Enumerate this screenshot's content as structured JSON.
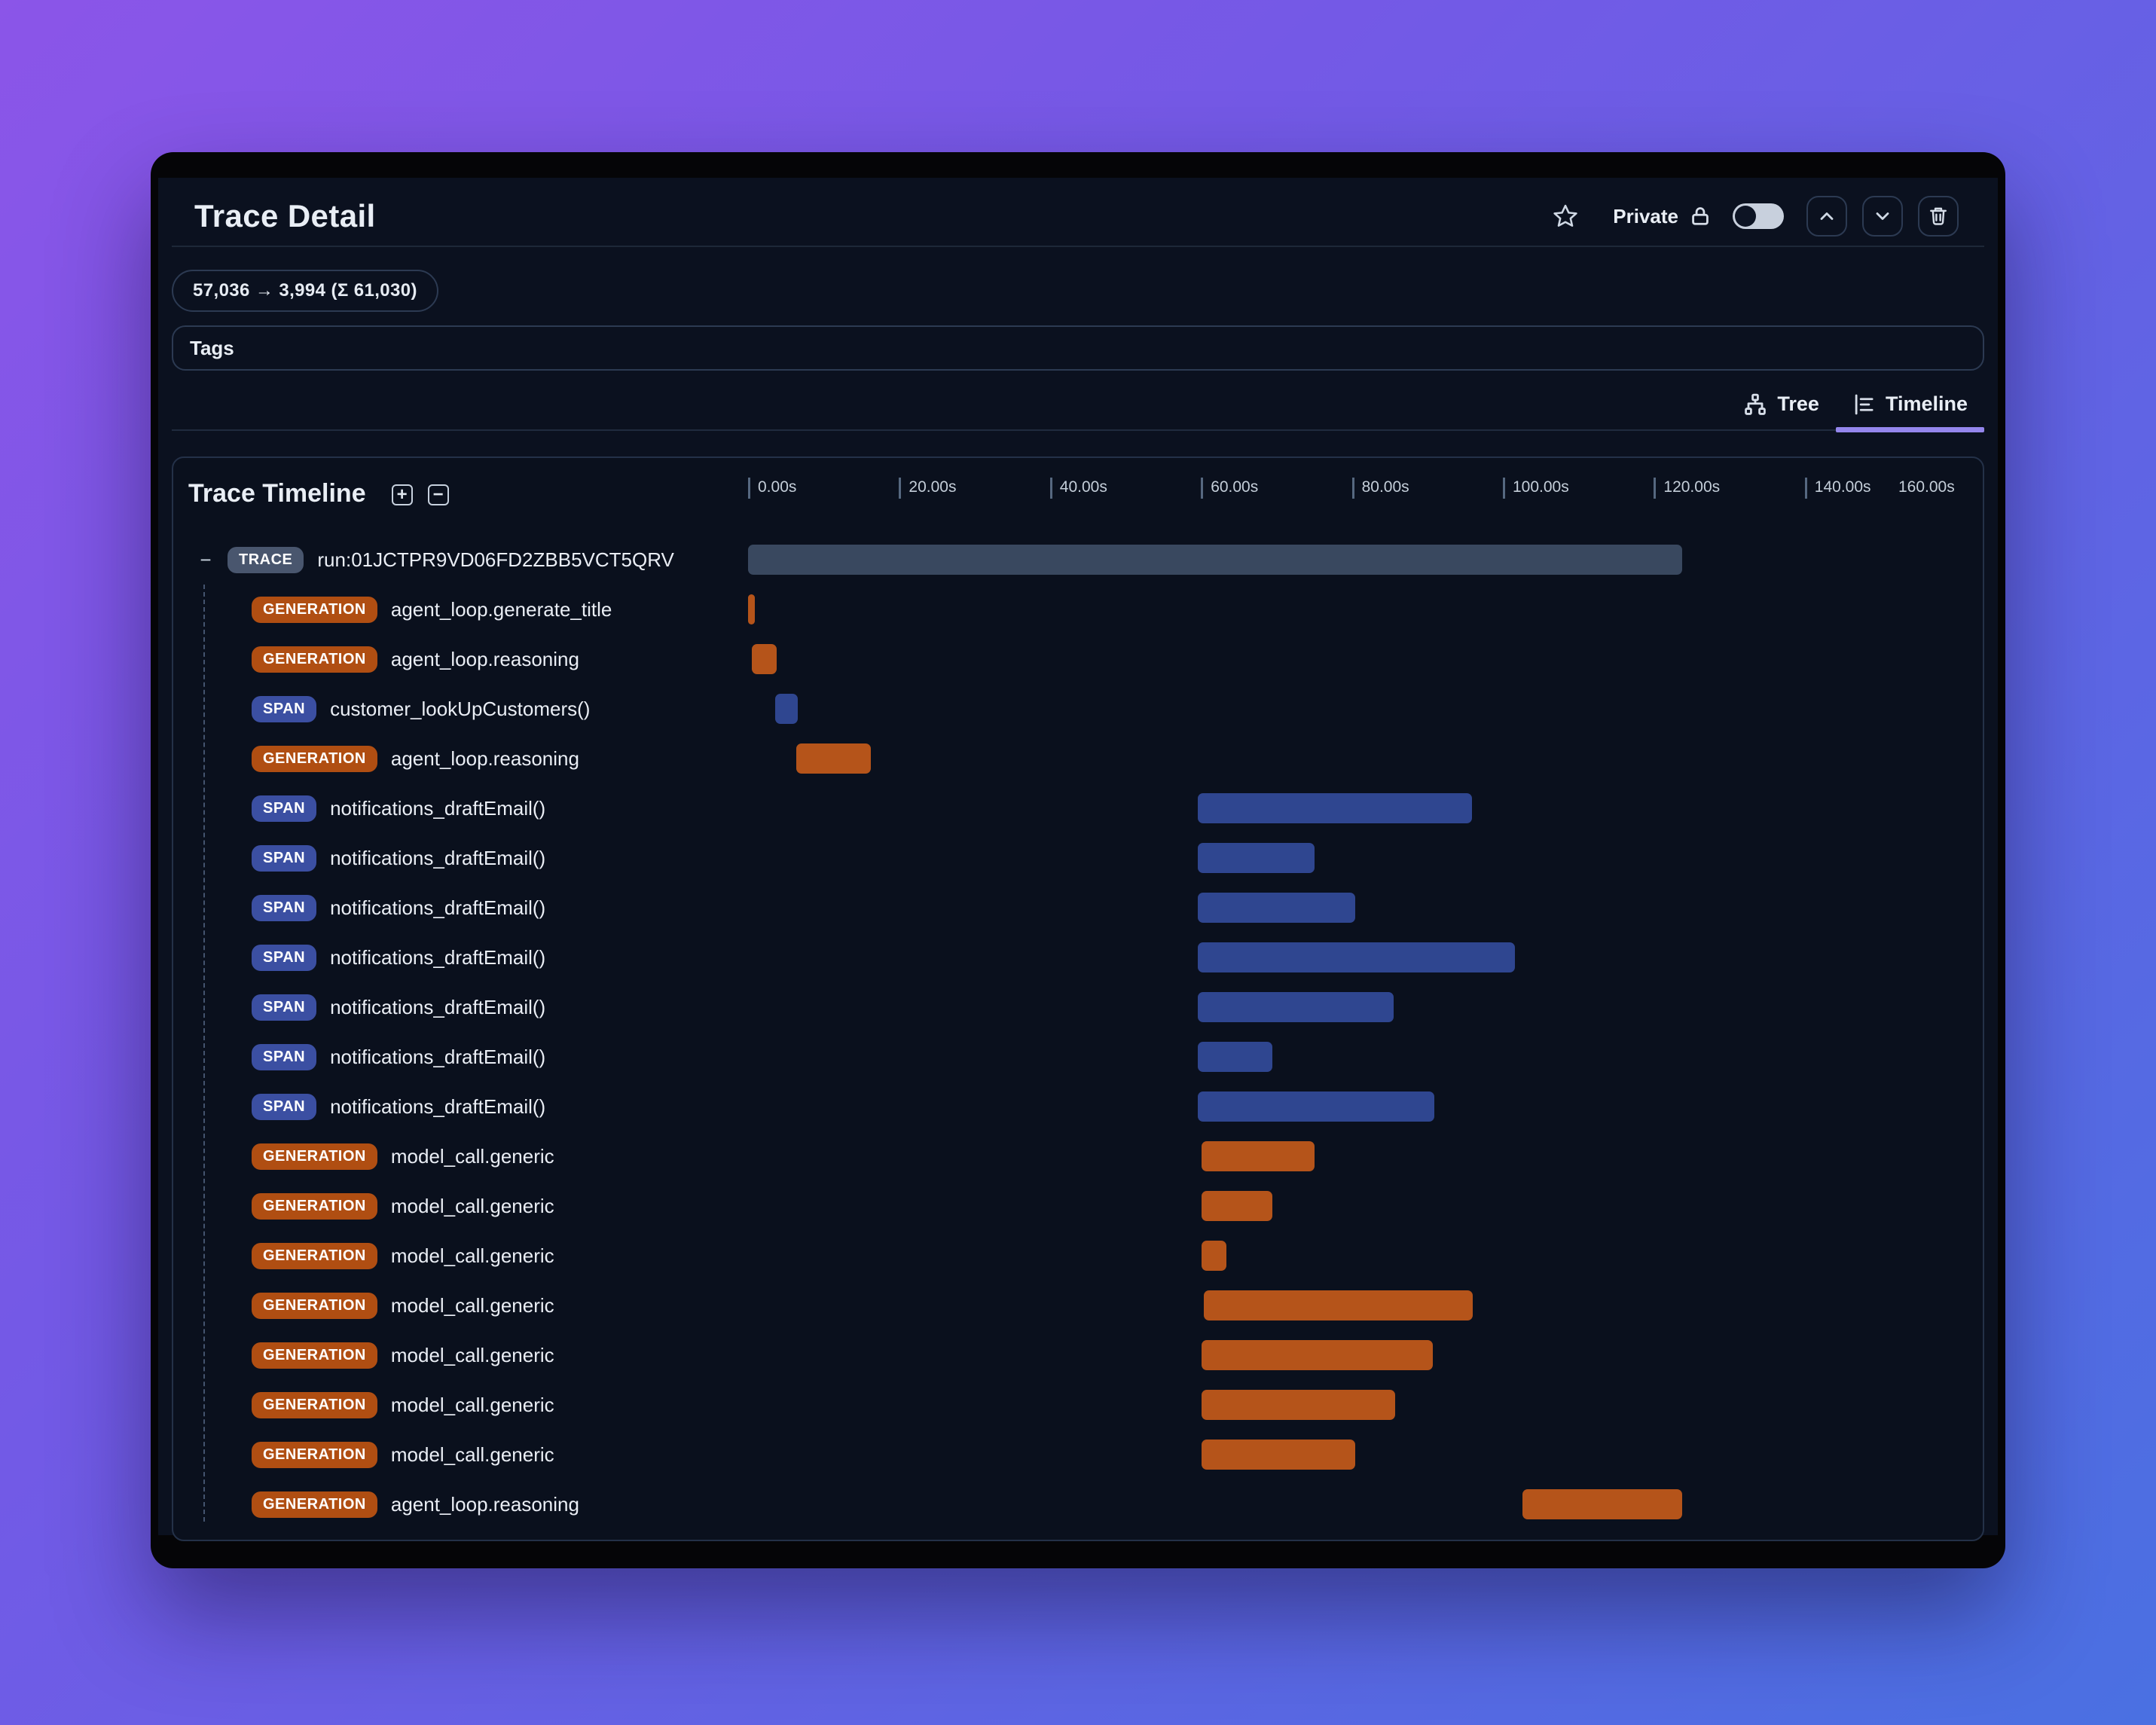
{
  "header": {
    "title": "Trace Detail",
    "privacy_label": "Private",
    "star_icon": "star-icon",
    "lock_icon": "lock-icon",
    "toggle_state": "off"
  },
  "token_usage": "57,036 → 3,994 (Σ 61,030)",
  "tags_label": "Tags",
  "tabs": [
    {
      "label": "Tree",
      "active": false
    },
    {
      "label": "Timeline",
      "active": true
    }
  ],
  "colors": {
    "accent": "#9486ec",
    "trace_badge": "#49566e",
    "generation_badge": "#b04e12",
    "span_badge": "#3b4fa2",
    "trace_bar": "#39485f",
    "generation_bar": "#b5541a",
    "span_bar": "#2f4690"
  },
  "timeline": {
    "title": "Trace Timeline",
    "expand_icon": "+",
    "collapse_icon": "−",
    "axis": {
      "unit": "seconds",
      "ticks": [
        {
          "t": 0,
          "label": "0.00s"
        },
        {
          "t": 20,
          "label": "20.00s"
        },
        {
          "t": 40,
          "label": "40.00s"
        },
        {
          "t": 60,
          "label": "60.00s"
        },
        {
          "t": 80,
          "label": "80.00s"
        },
        {
          "t": 100,
          "label": "100.00s"
        },
        {
          "t": 120,
          "label": "120.00s"
        },
        {
          "t": 140,
          "label": "140.00s"
        },
        {
          "t": 160,
          "label": "160.00s",
          "edge": "end"
        }
      ]
    },
    "rows": [
      {
        "type": "TRACE",
        "name": "run:01JCTPR9VD06FD2ZBB5VCT5QRV",
        "start_s": 0,
        "end_s": 123.8,
        "root": true
      },
      {
        "type": "GENERATION",
        "name": "agent_loop.generate_title",
        "start_s": 0,
        "end_s": 0.9
      },
      {
        "type": "GENERATION",
        "name": "agent_loop.reasoning",
        "start_s": 0.5,
        "end_s": 3.8
      },
      {
        "type": "SPAN",
        "name": "customer_lookUpCustomers()",
        "start_s": 3.6,
        "end_s": 6.6
      },
      {
        "type": "GENERATION",
        "name": "agent_loop.reasoning",
        "start_s": 6.4,
        "end_s": 16.3
      },
      {
        "type": "SPAN",
        "name": "notifications_draftEmail()",
        "start_s": 59.6,
        "end_s": 95.9
      },
      {
        "type": "SPAN",
        "name": "notifications_draftEmail()",
        "start_s": 59.6,
        "end_s": 75.1
      },
      {
        "type": "SPAN",
        "name": "notifications_draftEmail()",
        "start_s": 59.6,
        "end_s": 80.4
      },
      {
        "type": "SPAN",
        "name": "notifications_draftEmail()",
        "start_s": 59.6,
        "end_s": 101.6
      },
      {
        "type": "SPAN",
        "name": "notifications_draftEmail()",
        "start_s": 59.6,
        "end_s": 85.5
      },
      {
        "type": "SPAN",
        "name": "notifications_draftEmail()",
        "start_s": 59.6,
        "end_s": 69.5
      },
      {
        "type": "SPAN",
        "name": "notifications_draftEmail()",
        "start_s": 59.6,
        "end_s": 90.9
      },
      {
        "type": "GENERATION",
        "name": "model_call.generic",
        "start_s": 60.1,
        "end_s": 75.1
      },
      {
        "type": "GENERATION",
        "name": "model_call.generic",
        "start_s": 60.1,
        "end_s": 69.5
      },
      {
        "type": "GENERATION",
        "name": "model_call.generic",
        "start_s": 60.1,
        "end_s": 63.4
      },
      {
        "type": "GENERATION",
        "name": "model_call.generic",
        "start_s": 60.4,
        "end_s": 96.0
      },
      {
        "type": "GENERATION",
        "name": "model_call.generic",
        "start_s": 60.1,
        "end_s": 90.7
      },
      {
        "type": "GENERATION",
        "name": "model_call.generic",
        "start_s": 60.1,
        "end_s": 85.7
      },
      {
        "type": "GENERATION",
        "name": "model_call.generic",
        "start_s": 60.1,
        "end_s": 80.4
      },
      {
        "type": "GENERATION",
        "name": "agent_loop.reasoning",
        "start_s": 102.6,
        "end_s": 123.8
      }
    ]
  }
}
